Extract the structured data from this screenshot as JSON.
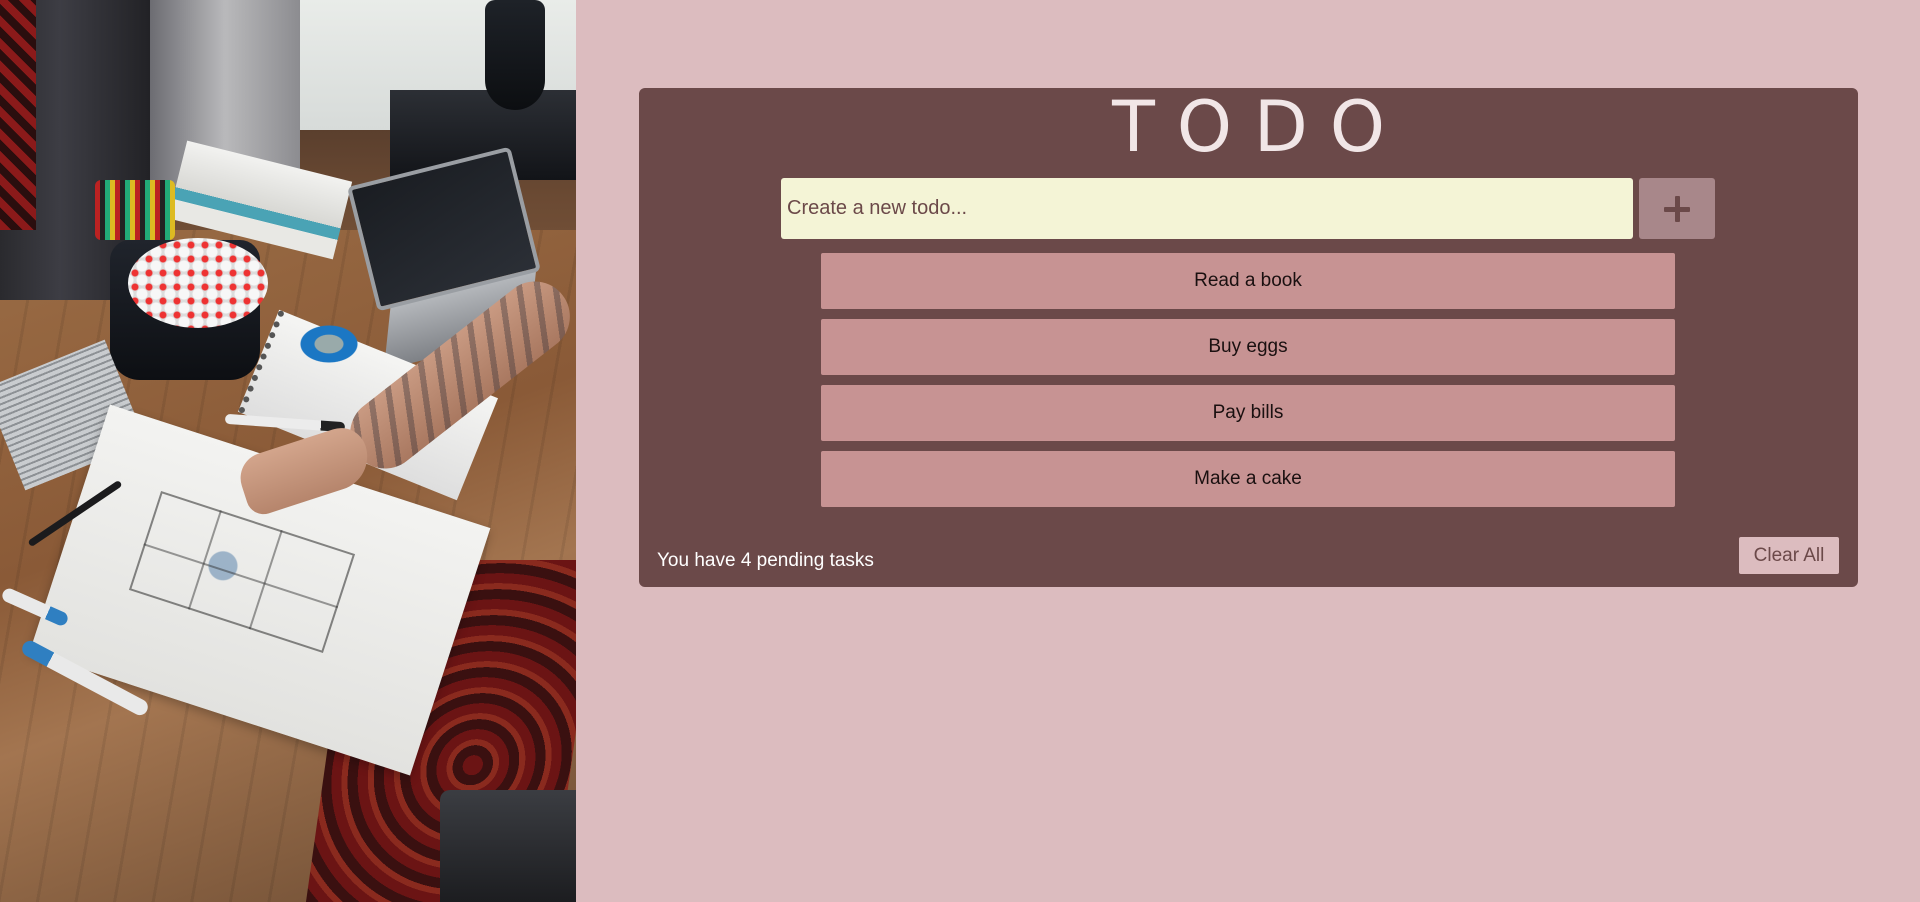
{
  "colors": {
    "page_background": "#dcbcbf",
    "card_background": "#6b4949",
    "title_text": "#f1e6e7",
    "input_background": "#f4f4d6",
    "add_button_background": "#a8878a",
    "todo_item_background": "#c79393",
    "clear_button_background": "#dcbcbf"
  },
  "hero_image": {
    "icon": "desk-workspace-photo"
  },
  "app": {
    "title": "TODO"
  },
  "new_todo": {
    "value": "",
    "placeholder": "Create a new todo...",
    "add_button_icon": "plus-icon"
  },
  "todos": [
    {
      "text": "Read a book"
    },
    {
      "text": "Buy eggs"
    },
    {
      "text": "Pay bills"
    },
    {
      "text": "Make a cake"
    }
  ],
  "footer": {
    "status": "You have 4 pending tasks",
    "clear_label": "Clear All"
  }
}
